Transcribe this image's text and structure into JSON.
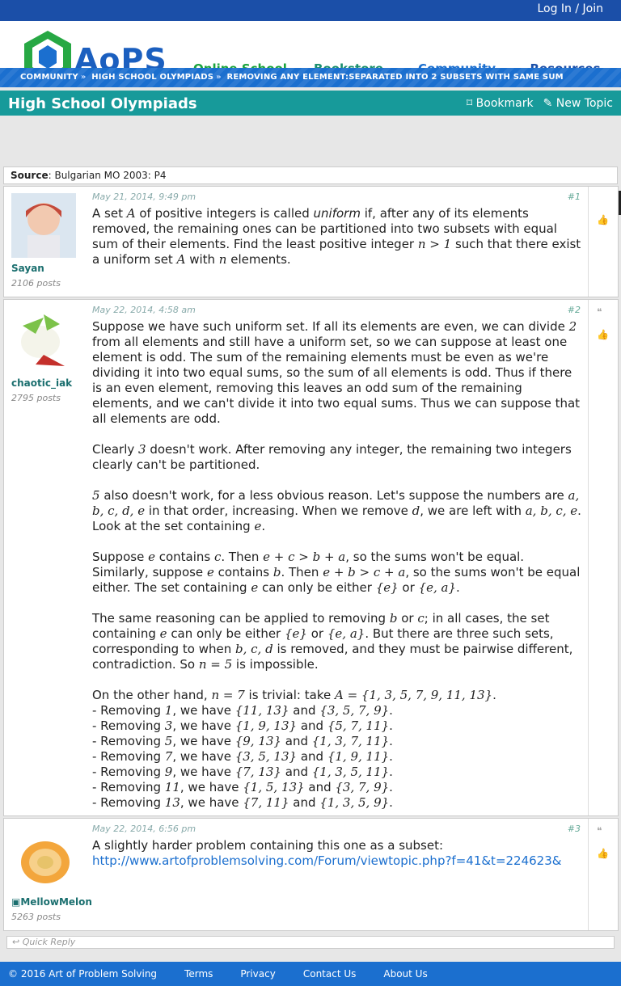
{
  "topbar": {
    "login_label": "Log In / Join"
  },
  "logo": {
    "text": "AoPS"
  },
  "nav": {
    "items": [
      "Online School",
      "Bookstore",
      "Community",
      "Resources"
    ]
  },
  "breadcrumb": {
    "items": [
      "COMMUNITY",
      "HIGH SCHOOL OLYMPIADS",
      "REMOVING ANY ELEMENT:SEPARATED INTO 2 SUBSETS WITH SAME SUM"
    ],
    "separator": "»"
  },
  "forum": {
    "title": "High School Olympiads",
    "bookmark_label": "Bookmark",
    "new_topic_label": "New Topic"
  },
  "source": {
    "label": "Source",
    "value": ": Bulgarian MO 2003: P4"
  },
  "posts": [
    {
      "user": "Sayan",
      "posts": "2106 posts",
      "date": "May 21, 2014, 9:49 pm",
      "num": "#1"
    },
    {
      "user": "chaotic_iak",
      "posts": "2795 posts",
      "date": "May 22, 2014, 4:58 am",
      "num": "#2"
    },
    {
      "user": "MellowMelon",
      "posts": "5263 posts",
      "date": "May 22, 2014, 6:56 pm",
      "num": "#3",
      "text": "A slightly harder problem containing this one as a subset:",
      "link": "http://www.artofproblemsolving.com/Forum/viewtopic.php?f=41&t=224623&"
    }
  ],
  "quick_reply": {
    "label": "Quick Reply"
  },
  "footer": {
    "copyright": "© 2016 Art of Problem Solving",
    "links": [
      "Terms",
      "Privacy",
      "Contact Us",
      "About Us"
    ]
  }
}
